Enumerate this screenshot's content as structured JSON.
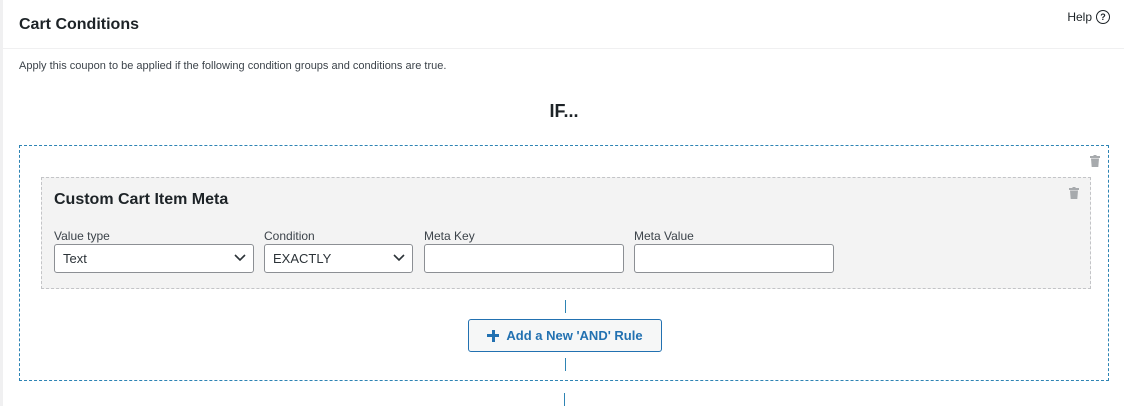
{
  "panel": {
    "title": "Cart Conditions",
    "help_label": "Help",
    "help_icon": "question-circle-icon",
    "description": "Apply this coupon to be applied if the following condition groups and conditions are true."
  },
  "logic": {
    "if_label": "IF..."
  },
  "group": {
    "delete_icon": "trash-icon",
    "condition": {
      "title": "Custom Cart Item Meta",
      "delete_icon": "trash-icon",
      "fields": {
        "value_type": {
          "label": "Value type",
          "value": "Text"
        },
        "condition": {
          "label": "Condition",
          "value": "EXACTLY"
        },
        "meta_key": {
          "label": "Meta Key",
          "value": "",
          "placeholder": ""
        },
        "meta_value": {
          "label": "Meta Value",
          "value": "",
          "placeholder": ""
        }
      }
    },
    "add_rule_label": "Add a New 'AND' Rule",
    "add_rule_icon": "plus-icon"
  },
  "colors": {
    "accent": "#2271b1",
    "dashed_border": "#2e84b4",
    "condition_bg": "#f3f3f3"
  }
}
